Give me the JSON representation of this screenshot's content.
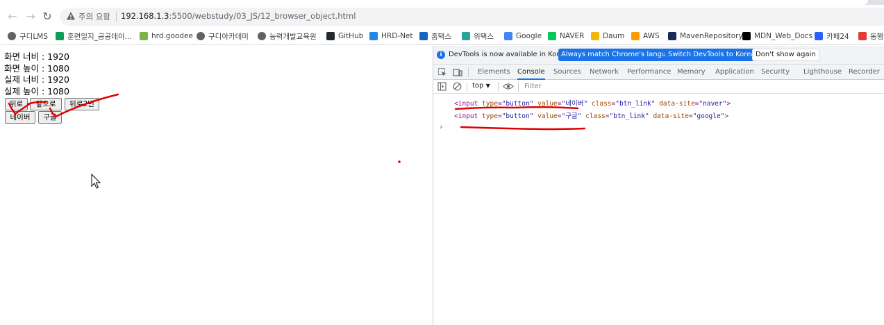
{
  "browser": {
    "security_warning": "주의 요함",
    "url_host": "192.168.1.3",
    "url_rest": ":5500/webstudy/03_JS/12_browser_object.html"
  },
  "bookmarks": [
    {
      "label": "구디LMS",
      "icon": "globe-icon",
      "color": "#5f6368"
    },
    {
      "label": "훈련일지_공공데이...",
      "icon": "sheets-icon",
      "color": "#0f9d58"
    },
    {
      "label": "hrd.goodee",
      "icon": "leaf-icon",
      "color": "#7cb342"
    },
    {
      "label": "구디아카데미",
      "icon": "globe-icon",
      "color": "#5f6368"
    },
    {
      "label": "능력개발교육원",
      "icon": "globe-icon",
      "color": "#5f6368"
    },
    {
      "label": "GitHub",
      "icon": "github-icon",
      "color": "#24292e"
    },
    {
      "label": "HRD-Net",
      "icon": "hrdnet-icon",
      "color": "#1e88e5"
    },
    {
      "label": "홈택스",
      "icon": "hometax-icon",
      "color": "#1565c0"
    },
    {
      "label": "위택스",
      "icon": "wetax-icon",
      "color": "#26a69a"
    },
    {
      "label": "Google",
      "icon": "google-icon",
      "color": "#4285f4"
    },
    {
      "label": "NAVER",
      "icon": "naver-icon",
      "color": "#03c75a"
    },
    {
      "label": "Daum",
      "icon": "daum-icon",
      "color": "#f2b705"
    },
    {
      "label": "AWS",
      "icon": "aws-icon",
      "color": "#ff9900"
    },
    {
      "label": "MavenRepository",
      "icon": "maven-icon",
      "color": "#1a2b57"
    },
    {
      "label": "MDN_Web_Docs",
      "icon": "mdn-icon",
      "color": "#000000"
    },
    {
      "label": "카페24",
      "icon": "cafe24-icon",
      "color": "#2962ff"
    },
    {
      "label": "동행",
      "icon": "donghaeng-icon",
      "color": "#e53935"
    }
  ],
  "page": {
    "lines": [
      "화면 너비 : 1920",
      "화면 높이 : 1080",
      "실제 너비 : 1920",
      "실제 높이 : 1080"
    ],
    "buttons_row1": [
      "뒤로",
      "앞으로",
      "뒤로2번"
    ],
    "buttons_row2": [
      "네이버",
      "구글"
    ]
  },
  "devtools": {
    "info_text": "DevTools is now available in Korean!",
    "btn_match": "Always match Chrome's language",
    "btn_switch": "Switch DevTools to Korean",
    "btn_dismiss": "Don't show again",
    "tabs": [
      "Elements",
      "Console",
      "Sources",
      "Network",
      "Performance",
      "Memory",
      "Application",
      "Security",
      "Lighthouse",
      "Recorder"
    ],
    "active_tab": "Console",
    "context": "top",
    "filter_placeholder": "Filter",
    "console_lines": [
      {
        "value": "네이버",
        "site": "naver"
      },
      {
        "value": "구글",
        "site": "google"
      }
    ],
    "prompt": "›"
  },
  "colors": {
    "accent": "#1a73e8",
    "annotation_red": "#e00000"
  }
}
